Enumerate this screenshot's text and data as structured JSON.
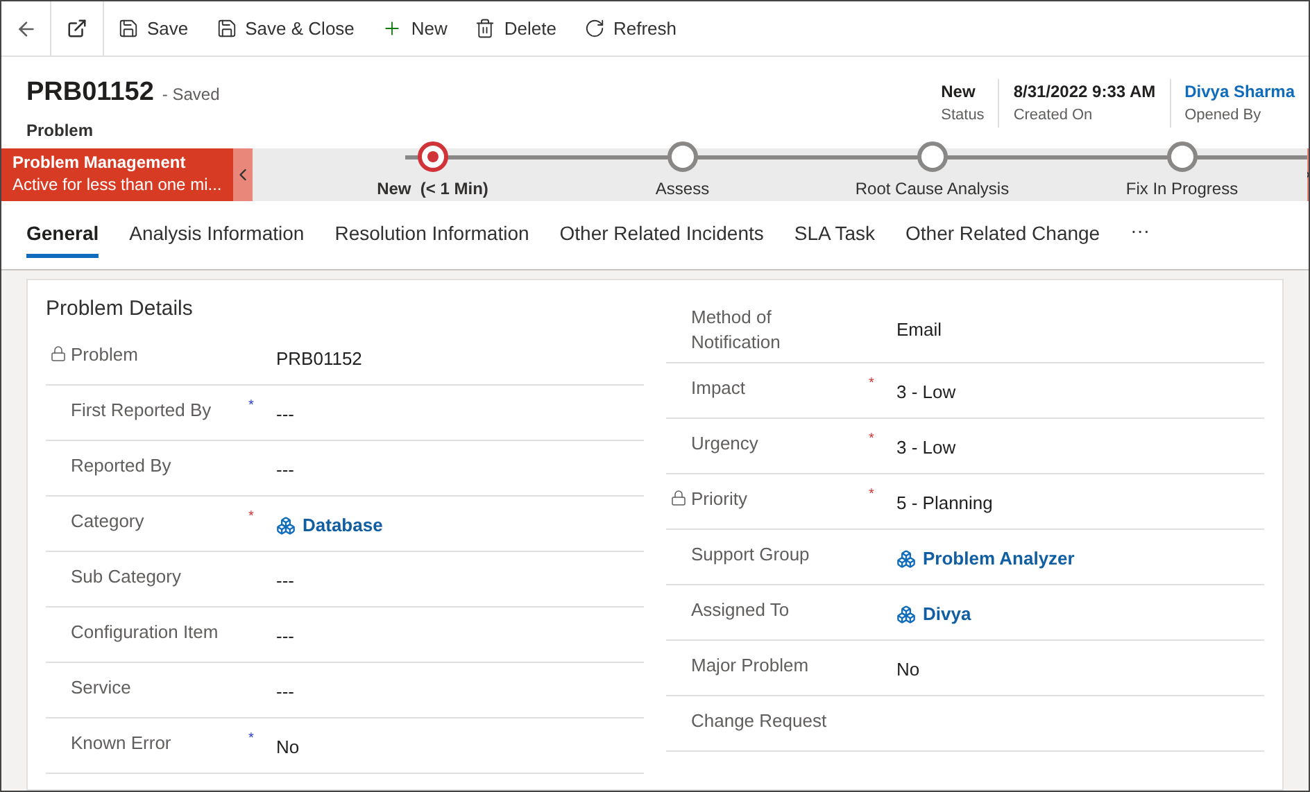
{
  "toolbar": {
    "buttons": [
      {
        "kind": "save",
        "label": "Save"
      },
      {
        "kind": "save-close",
        "label": "Save & Close"
      },
      {
        "kind": "new",
        "label": "New"
      },
      {
        "kind": "delete",
        "label": "Delete"
      },
      {
        "kind": "refresh",
        "label": "Refresh"
      }
    ]
  },
  "header": {
    "title": "PRB01152",
    "save_state": "- Saved",
    "entity": "Problem",
    "fields": [
      {
        "kind": "text",
        "value": "New",
        "label": "Status"
      },
      {
        "kind": "text",
        "value": "8/31/2022 9:33 AM",
        "label": "Created On"
      },
      {
        "kind": "link",
        "value": "Divya Sharma",
        "label": "Opened By"
      }
    ]
  },
  "process": {
    "name": "Problem Management",
    "subtitle": "Active for less than one mi...",
    "stages": [
      {
        "label": "New  (< 1 Min)",
        "selected": true
      },
      {
        "label": "Assess",
        "selected": false
      },
      {
        "label": "Root Cause Analysis",
        "selected": false
      },
      {
        "label": "Fix In Progress",
        "selected": false
      }
    ]
  },
  "tabs": [
    {
      "label": "General",
      "selected": true
    },
    {
      "label": "Analysis Information",
      "selected": false
    },
    {
      "label": "Resolution Information",
      "selected": false
    },
    {
      "label": "Other Related Incidents",
      "selected": false
    },
    {
      "label": "SLA Task",
      "selected": false
    },
    {
      "label": "Other Related Change",
      "selected": false
    }
  ],
  "more_tabs": "···",
  "section": {
    "title": "Problem Details",
    "left": [
      {
        "label": "Problem",
        "locked": true,
        "kind": "text",
        "value": "PRB01152"
      },
      {
        "label": "First Reported By",
        "locked": false,
        "mark": {
          "text": "*",
          "color": "#2a3ad4"
        },
        "kind": "text",
        "value": "---"
      },
      {
        "label": "Reported By",
        "locked": false,
        "kind": "text",
        "value": "---"
      },
      {
        "label": "Category",
        "locked": false,
        "mark": {
          "text": "*",
          "color": "#d13438"
        },
        "kind": "link",
        "value": "Database"
      },
      {
        "label": "Sub Category",
        "locked": false,
        "kind": "text",
        "value": "---"
      },
      {
        "label": "Configuration Item",
        "locked": false,
        "kind": "text",
        "value": "---"
      },
      {
        "label": "Service",
        "locked": false,
        "kind": "text",
        "value": "---"
      },
      {
        "label": "Known Error",
        "locked": false,
        "mark": {
          "text": "*",
          "color": "#2a3ad4"
        },
        "kind": "text",
        "value": "No"
      }
    ],
    "right": [
      {
        "label": "Method of Notification",
        "locked": false,
        "kind": "text",
        "value": "Email"
      },
      {
        "label": "Impact",
        "locked": false,
        "mark": {
          "text": "*",
          "color": "#d13438"
        },
        "kind": "text",
        "value": "3 - Low"
      },
      {
        "label": "Urgency",
        "locked": false,
        "mark": {
          "text": "*",
          "color": "#d13438"
        },
        "kind": "text",
        "value": "3 - Low"
      },
      {
        "label": "Priority",
        "locked": true,
        "mark": {
          "text": "*",
          "color": "#d13438"
        },
        "kind": "text",
        "value": "5 - Planning"
      },
      {
        "label": "Support Group",
        "locked": false,
        "kind": "link",
        "value": "Problem Analyzer"
      },
      {
        "label": "Assigned To",
        "locked": false,
        "kind": "link",
        "value": "Divya"
      },
      {
        "label": "Major Problem",
        "locked": false,
        "kind": "text",
        "value": "No"
      },
      {
        "label": "Change Request",
        "locked": false,
        "kind": "text"
      }
    ]
  }
}
